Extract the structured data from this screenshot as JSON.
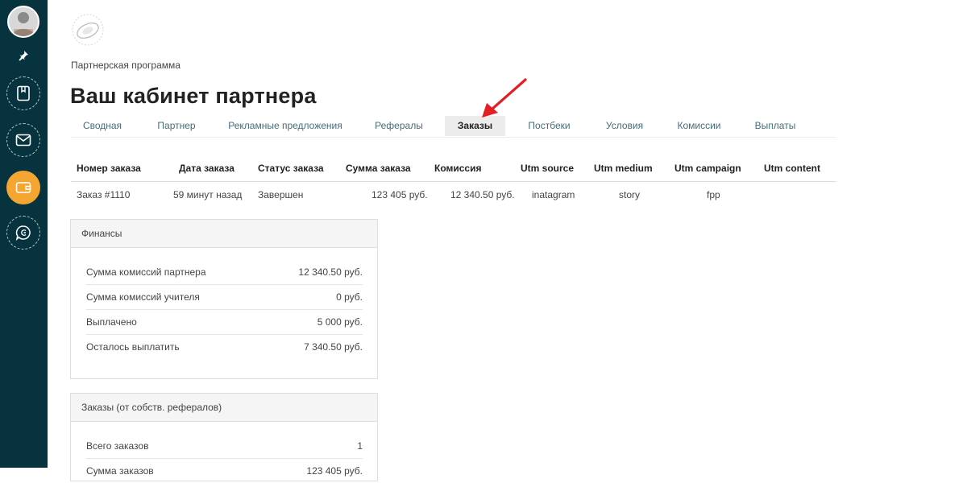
{
  "breadcrumb": "Партнерская программа",
  "page_title": "Ваш кабинет партнера",
  "tabs": [
    {
      "label": "Сводная"
    },
    {
      "label": "Партнер"
    },
    {
      "label": "Рекламные предложения"
    },
    {
      "label": "Рефералы"
    },
    {
      "label": "Заказы"
    },
    {
      "label": "Постбеки"
    },
    {
      "label": "Условия"
    },
    {
      "label": "Комиссии"
    },
    {
      "label": "Выплаты"
    }
  ],
  "active_tab": "Заказы",
  "orders": {
    "headers": [
      "Номер заказа",
      "Дата заказа",
      "Статус заказа",
      "Сумма заказа",
      "Комиссия",
      "Utm source",
      "Utm medium",
      "Utm campaign",
      "Utm content"
    ],
    "rows": [
      [
        "Заказ #1110",
        "59 минут назад",
        "Завершен",
        "123 405 руб.",
        "12 340.50 руб.",
        "inatagram",
        "story",
        "fpp",
        ""
      ]
    ]
  },
  "finance": {
    "title": "Финансы",
    "items": [
      {
        "label": "Сумма комиссий партнера",
        "value": "12 340.50 руб."
      },
      {
        "label": "Сумма комиссий учителя",
        "value": "0 руб."
      },
      {
        "label": "Выплачено",
        "value": "5 000 руб."
      },
      {
        "label": "Осталось выплатить",
        "value": "7 340.50 руб."
      }
    ]
  },
  "referral_orders": {
    "title": "Заказы (от собств. рефералов)",
    "items": [
      {
        "label": "Всего заказов",
        "value": "1"
      },
      {
        "label": "Сумма заказов",
        "value": "123 405 руб."
      }
    ]
  },
  "colors": {
    "sidebar": "#07333e",
    "active_nav": "#f4a532",
    "tab_text": "#466c79",
    "annotation_arrow": "#e31e24"
  },
  "icons": {
    "sidebar": [
      "avatar",
      "pin-icon",
      "book-icon",
      "mail-icon",
      "wallet-icon",
      "chat-icon"
    ]
  }
}
